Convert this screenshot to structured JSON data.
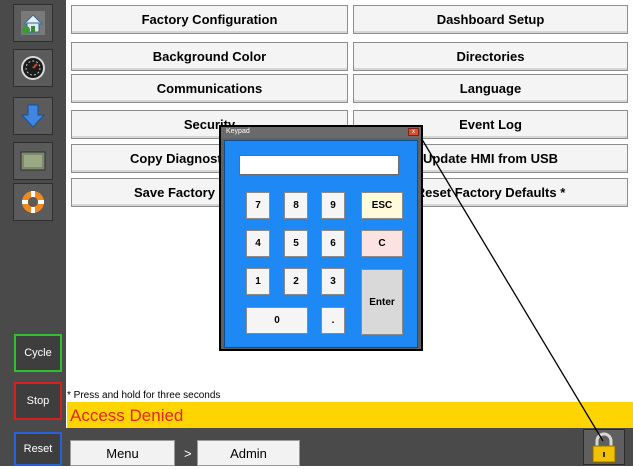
{
  "grid": {
    "left": [
      "Factory Configuration",
      "Background Color",
      "Communications",
      "Security",
      "Copy Diagnost",
      "Save Factory"
    ],
    "right": [
      "Dashboard Setup",
      "Directories",
      "Language",
      "Event Log",
      "Update HMI from USB",
      "Reset Factory Defaults *"
    ]
  },
  "sidebar": {
    "icons": [
      "home-icon",
      "gauge-icon",
      "download-arrow-icon",
      "screen-icon",
      "lifebuoy-icon"
    ],
    "cycle_label": "Cycle",
    "stop_label": "Stop",
    "reset_label": "Reset"
  },
  "footnote": "* Press and hold for three seconds",
  "status_message": "Access Denied",
  "breadcrumb": {
    "menu": "Menu",
    "separator": ">",
    "admin": "Admin"
  },
  "keypad": {
    "title": "Keypad",
    "close_label": "x",
    "keys": {
      "k7": "7",
      "k8": "8",
      "k9": "9",
      "esc": "ESC",
      "k4": "4",
      "k5": "5",
      "k6": "6",
      "clear": "C",
      "k1": "1",
      "k2": "2",
      "k3": "3",
      "enter": "Enter",
      "k0": "0",
      "dot": "."
    }
  },
  "colors": {
    "sidebar": "#4a4a4a",
    "status_bg": "#ffd500",
    "status_text": "#e52620",
    "keypad_bg": "#1e88f4",
    "cycle_border": "#2fbf2f",
    "stop_border": "#d62020",
    "reset_border": "#2a61d8"
  }
}
